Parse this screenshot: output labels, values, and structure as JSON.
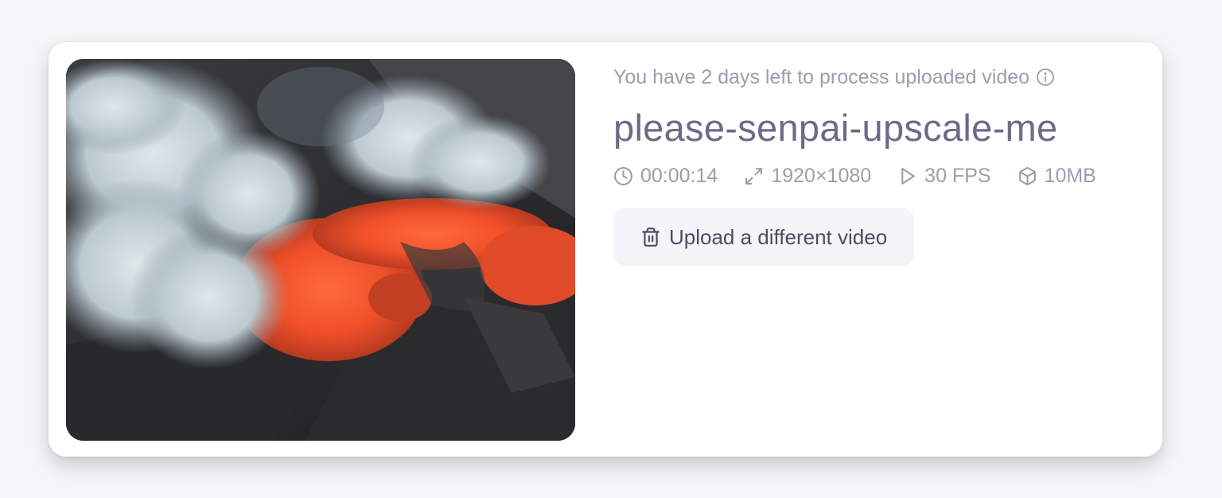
{
  "notice": {
    "text": "You have 2 days left to process uploaded video",
    "icon": "info-icon"
  },
  "video": {
    "title": "please-senpai-upscale-me",
    "thumbnail_icon": "video-thumbnail"
  },
  "meta": {
    "duration": "00:00:14",
    "duration_icon": "clock-icon",
    "resolution": "1920×1080",
    "resolution_icon": "expand-icon",
    "fps": "30 FPS",
    "fps_icon": "play-icon",
    "size": "10MB",
    "size_icon": "cube-icon"
  },
  "actions": {
    "upload_label": "Upload a different video",
    "upload_icon": "trash-icon"
  },
  "colors": {
    "muted_text": "#9d9cb0",
    "title_text": "#6c6a88",
    "button_bg": "#f4f4f9",
    "button_text": "#4d4b66",
    "card_bg": "#ffffff"
  }
}
